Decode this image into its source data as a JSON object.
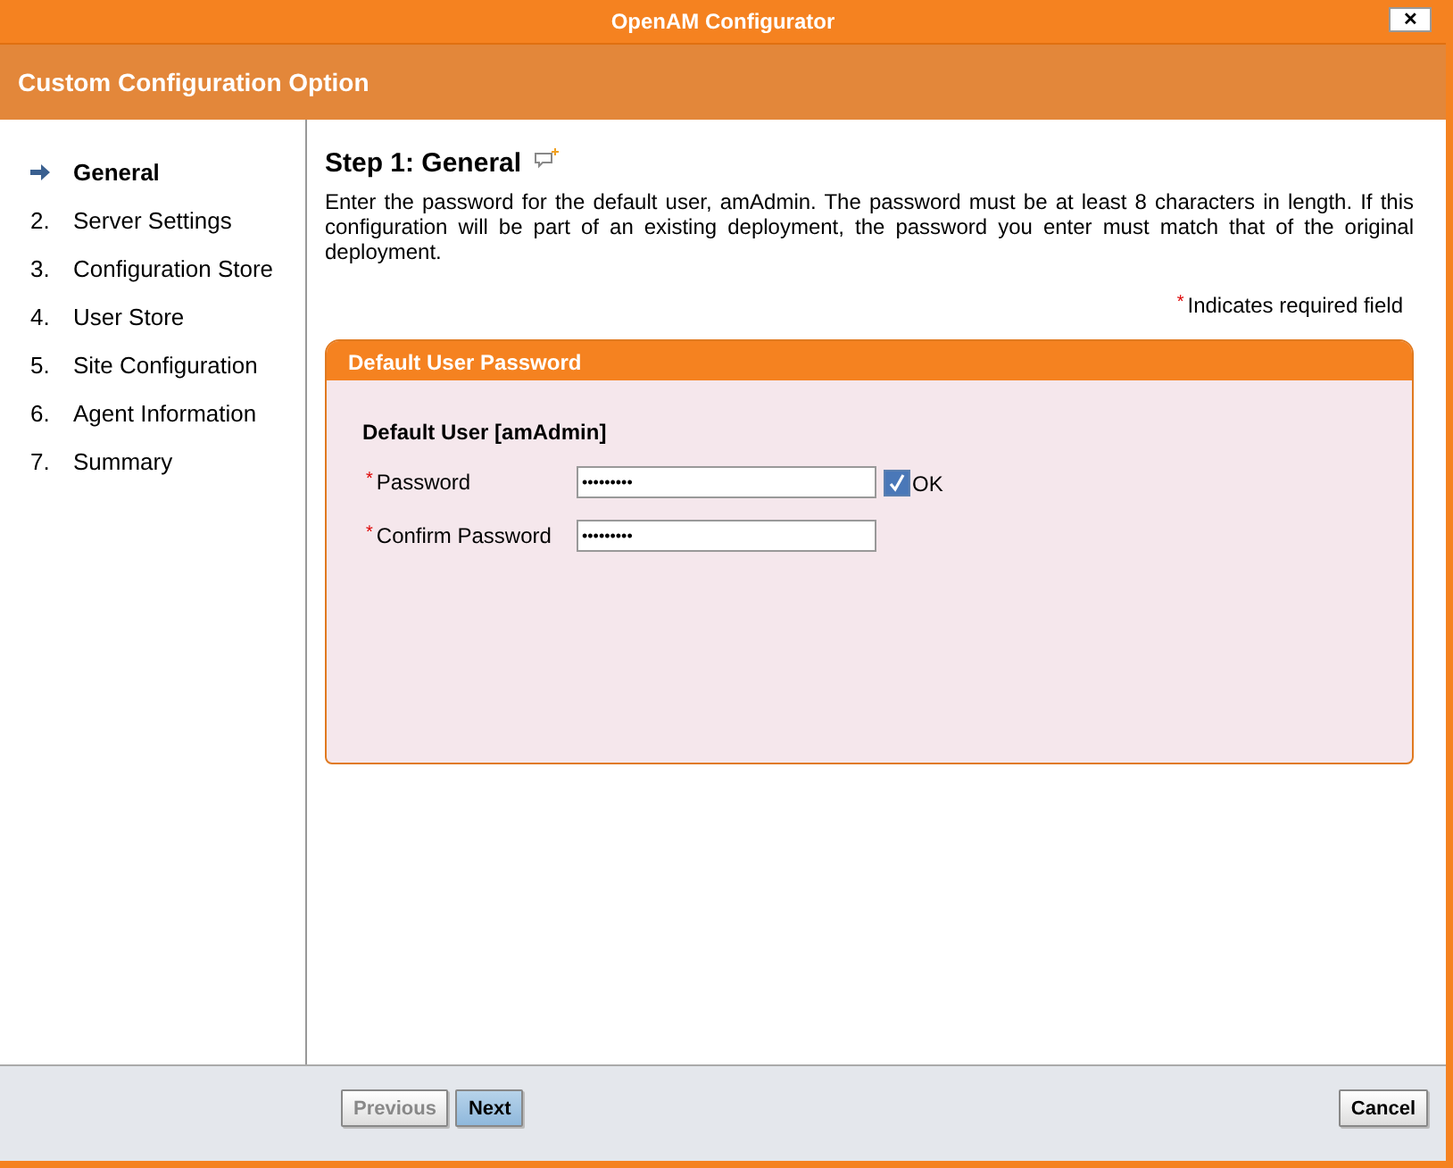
{
  "window": {
    "title": "OpenAM Configurator",
    "close_label": "✕"
  },
  "header": {
    "title": "Custom Configuration Option"
  },
  "steps": [
    {
      "label": "General",
      "selected": true
    },
    {
      "number": "2.",
      "label": "Server Settings",
      "selected": false
    },
    {
      "number": "3.",
      "label": "Configuration Store",
      "selected": false
    },
    {
      "number": "4.",
      "label": "User Store",
      "selected": false
    },
    {
      "number": "5.",
      "label": "Site Configuration",
      "selected": false
    },
    {
      "number": "6.",
      "label": "Agent Information",
      "selected": false
    },
    {
      "number": "7.",
      "label": "Summary",
      "selected": false
    }
  ],
  "content": {
    "heading": "Step 1: General",
    "description": "Enter the password for the default user, amAdmin. The password must be at least 8 characters in length. If this configuration will be part of an existing deployment, the password you enter must match that of the original deployment.",
    "required_mark": "*",
    "required_note": "Indicates required field",
    "panel": {
      "title": "Default User Password",
      "subtitle": "Default User [amAdmin]",
      "fields": [
        {
          "label": "Password",
          "required": true,
          "value": "•••••••••",
          "check": {
            "checked": true,
            "label": "OK"
          }
        },
        {
          "label": "Confirm Password",
          "required": true,
          "value": "•••••••••"
        }
      ]
    }
  },
  "buttons": [
    {
      "label": "Previous",
      "kind": "nav",
      "disabled": true,
      "primary": false
    },
    {
      "label": "Next",
      "kind": "nav",
      "disabled": false,
      "primary": true
    },
    {
      "label": "Cancel",
      "kind": "cancel",
      "disabled": false,
      "primary": false
    }
  ]
}
